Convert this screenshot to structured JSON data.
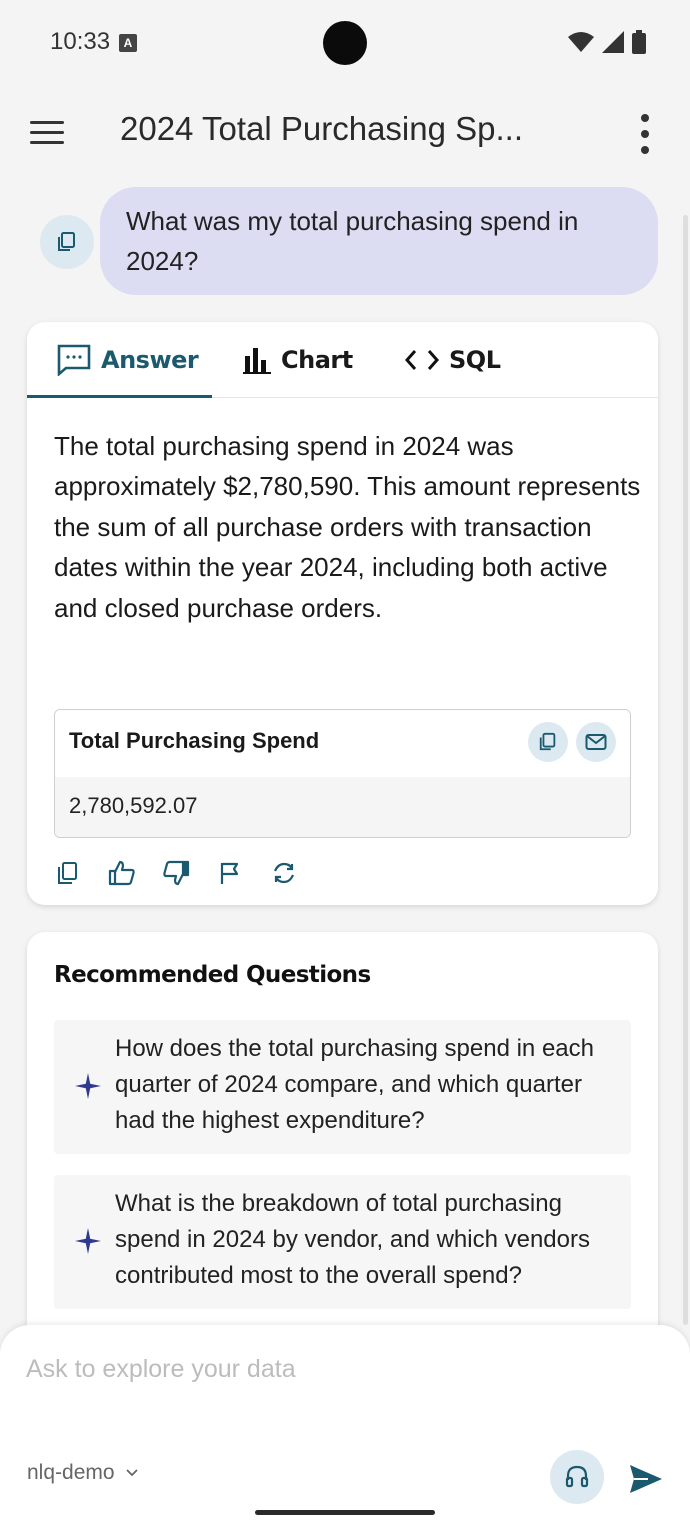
{
  "status_bar": {
    "time": "10:33",
    "icons": [
      "wifi-icon",
      "signal-icon",
      "battery-icon"
    ]
  },
  "header": {
    "title": "2024 Total Purchasing Sp...",
    "menu_icon": "hamburger-menu-icon",
    "more_icon": "more-vertical-icon"
  },
  "user_message": {
    "text": "What was my total purchasing spend in 2024?",
    "icon": "copy-icon"
  },
  "answer_card": {
    "tabs": [
      {
        "label": "Answer",
        "icon": "message-dots-icon",
        "active": true
      },
      {
        "label": "Chart",
        "icon": "bar-chart-icon",
        "active": false
      },
      {
        "label": "SQL",
        "icon": "code-icon",
        "active": false
      }
    ],
    "answer_text": "The total purchasing spend in 2024 was approximately $2,780,590. This amount represents the sum of all purchase orders with transaction dates within the year 2024, including both active and closed purchase orders.",
    "result": {
      "column": "Total Purchasing Spend",
      "value": "2,780,592.07",
      "actions": [
        "copy-icon",
        "mail-icon"
      ]
    },
    "feedback_icons": [
      "copy-icon",
      "thumbs-up-icon",
      "thumbs-down-icon",
      "flag-icon",
      "refresh-icon"
    ]
  },
  "recommended": {
    "title": "Recommended Questions",
    "items": [
      {
        "text": "How does the total purchasing spend in each quarter of 2024 compare, and which quarter had the highest expenditure?",
        "icon": "sparkle-icon"
      },
      {
        "text": "What is the breakdown of total purchasing spend in 2024 by vendor, and which vendors contributed most to the overall spend?",
        "icon": "sparkle-icon"
      }
    ]
  },
  "composer": {
    "placeholder": "Ask to explore your data",
    "value": "",
    "workspace": "nlq-demo",
    "icons": [
      "chevron-down-icon",
      "headset-icon",
      "send-icon"
    ]
  },
  "colors": {
    "accent": "#1b5a6e",
    "user_bubble": "#dcdcf3",
    "icon_circle": "#dde9f0",
    "sparkle": "#2f3a8f",
    "send": "#1b5a6e"
  }
}
